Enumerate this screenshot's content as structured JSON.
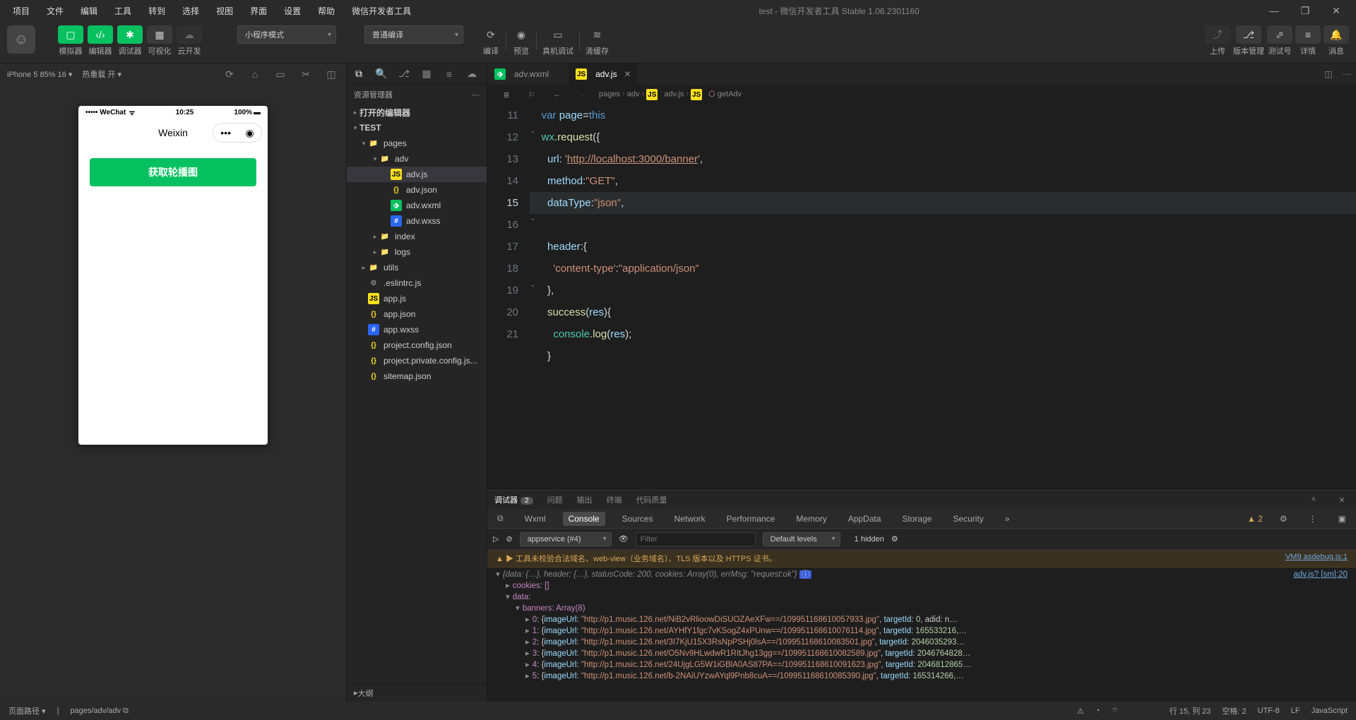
{
  "menu": [
    "项目",
    "文件",
    "编辑",
    "工具",
    "转到",
    "选择",
    "视图",
    "界面",
    "设置",
    "帮助",
    "微信开发者工具"
  ],
  "windowTitle": "test - 微信开发者工具 Stable 1.06.2301160",
  "toolbar": {
    "modes": [
      {
        "label": "模拟器"
      },
      {
        "label": "编辑器"
      },
      {
        "label": "调试器"
      },
      {
        "label": "可视化"
      },
      {
        "label": "云开发"
      }
    ],
    "modeDropdown": "小程序模式",
    "compileDropdown": "普通编译",
    "actions": [
      {
        "label": "编译"
      },
      {
        "label": "预览"
      },
      {
        "label": "真机调试"
      },
      {
        "label": "清缓存"
      }
    ],
    "right": [
      {
        "label": "上传"
      },
      {
        "label": "版本管理"
      },
      {
        "label": "测试号"
      },
      {
        "label": "详情"
      },
      {
        "label": "消息"
      }
    ]
  },
  "sim": {
    "device": "iPhone 5 85% 16",
    "reload": "热重载 开",
    "statusLeft": "••••• WeChat",
    "statusWifi": "ᯤ",
    "statusTime": "10:25",
    "statusBatt": "100%",
    "navTitle": "Weixin",
    "btn": "获取轮播图"
  },
  "explorer": {
    "title": "资源管理器",
    "sections": [
      "打开的编辑器",
      "TEST"
    ],
    "tree": [
      {
        "d": 0,
        "t": "pages",
        "k": "folder",
        "open": true
      },
      {
        "d": 1,
        "t": "adv",
        "k": "folder",
        "open": true
      },
      {
        "d": 2,
        "t": "adv.js",
        "k": "js",
        "sel": true
      },
      {
        "d": 2,
        "t": "adv.json",
        "k": "json"
      },
      {
        "d": 2,
        "t": "adv.wxml",
        "k": "wxml"
      },
      {
        "d": 2,
        "t": "adv.wxss",
        "k": "wxss"
      },
      {
        "d": 1,
        "t": "index",
        "k": "folder",
        "open": false
      },
      {
        "d": 1,
        "t": "logs",
        "k": "folder",
        "open": false
      },
      {
        "d": 0,
        "t": "utils",
        "k": "folder",
        "open": false
      },
      {
        "d": 0,
        "t": ".eslintrc.js",
        "k": "cfg"
      },
      {
        "d": 0,
        "t": "app.js",
        "k": "js"
      },
      {
        "d": 0,
        "t": "app.json",
        "k": "json"
      },
      {
        "d": 0,
        "t": "app.wxss",
        "k": "wxss"
      },
      {
        "d": 0,
        "t": "project.config.json",
        "k": "json"
      },
      {
        "d": 0,
        "t": "project.private.config.js...",
        "k": "json"
      },
      {
        "d": 0,
        "t": "sitemap.json",
        "k": "json"
      }
    ],
    "outline": "大纲"
  },
  "editor": {
    "tabs": [
      {
        "name": "adv.wxml",
        "icon": "wxml"
      },
      {
        "name": "adv.js",
        "icon": "js",
        "active": true,
        "close": true
      }
    ],
    "crumb": [
      "pages",
      "adv",
      "adv.js",
      "getAdv"
    ],
    "startLine": 11,
    "code": [
      {
        "n": 11,
        "html": "    <span class='kw'>var</span> <span class='prop'>page</span><span class='pun'>=</span><span class='kw'>this</span>"
      },
      {
        "n": 12,
        "html": "    <span class='obj'>wx</span><span class='pun'>.</span><span class='mth'>request</span><span class='pun'>({</span>"
      },
      {
        "n": 13,
        "html": "      <span class='prop'>url</span><span class='pun'>:</span> <span class='str'>'</span><span class='url'>http://localhost:3000/banner</span><span class='str'>'</span><span class='pun'>,</span>"
      },
      {
        "n": 14,
        "html": "      <span class='prop'>method</span><span class='pun'>:</span><span class='str'>\"GET\"</span><span class='pun'>,</span>"
      },
      {
        "n": 15,
        "html": "      <span class='prop'>dataType</span><span class='pun'>:</span><span class='str'>\"json\"</span><span class='pun'>,</span>",
        "cur": true
      },
      {
        "n": 16,
        "html": "      <span class='prop'>header</span><span class='pun'>:{</span>"
      },
      {
        "n": 17,
        "html": "        <span class='str'>'content-type'</span><span class='pun'>:</span><span class='str'>\"application/json\"</span>"
      },
      {
        "n": 18,
        "html": "      <span class='pun'>},</span>"
      },
      {
        "n": 19,
        "html": "      <span class='mth'>success</span><span class='pun'>(</span><span class='prop'>res</span><span class='pun'>){</span>"
      },
      {
        "n": 20,
        "html": "        <span class='obj'>console</span><span class='pun'>.</span><span class='mth'>log</span><span class='pun'>(</span><span class='prop'>res</span><span class='pun'>);</span>"
      },
      {
        "n": 21,
        "html": "      <span class='pun'>}</span>"
      }
    ]
  },
  "debug": {
    "tabs1": [
      {
        "t": "调试器",
        "badge": "2",
        "act": true
      },
      {
        "t": "问题"
      },
      {
        "t": "输出"
      },
      {
        "t": "终端"
      },
      {
        "t": "代码质量"
      }
    ],
    "tabs2": [
      "Wxml",
      "Console",
      "Sources",
      "Network",
      "Performance",
      "Memory",
      "AppData",
      "Storage",
      "Security"
    ],
    "tabs2active": "Console",
    "more": "»",
    "warnCount": "2",
    "context": "appservice (#4)",
    "filterPlaceholder": "Filter",
    "levels": "Default levels",
    "hidden": "1 hidden",
    "warnRow": "▲ ▶ 工具未校验合法域名、web-view（业务域名）、TLS 版本以及 HTTPS 证书。",
    "warnLink": "VM9 asdebug.js:1",
    "srcLink": "adv.js? [sm]:20",
    "objSummary": "{data: {…}, header: {…}, statusCode: 200, cookies: Array(0), errMsg: \"request:ok\"}",
    "cookies": "cookies: []",
    "dataLabel": "data:",
    "bannersLabel": "banners: Array(8)",
    "banners": [
      {
        "i": 0,
        "url": "http://p1.music.126.net/NiB2vRlioowDiSUOZAeXFw==/109951168610057933.jpg",
        "tid": "0",
        "extra": ", adid: n…"
      },
      {
        "i": 1,
        "url": "http://p1.music.126.net/AYHfY1fgc7vKSogZ4xPUnw==/109951168610076114.jpg",
        "tid": "165533216,…"
      },
      {
        "i": 2,
        "url": "http://p1.music.126.net/3I7KjU15X3RsNpPSHj0lsA==/109951168610083501.jpg",
        "tid": "2046035293…"
      },
      {
        "i": 3,
        "url": "http://p1.music.126.net/O5Nv9HLwdwR1RItJhg13gg==/109951168610082589.jpg",
        "tid": "2046764828…"
      },
      {
        "i": 4,
        "url": "http://p1.music.126.net/24UjgLG5W1iGBlA0AS87PA==/109951168610091623.jpg",
        "tid": "2046812865…"
      },
      {
        "i": 5,
        "url": "http://p1.music.126.net/b-2NAiUYzwAYql9Pnb8cuA==/109951168610085390.jpg",
        "tid": "165314266,…"
      }
    ]
  },
  "status": {
    "pathLabel": "页面路径",
    "path": "pages/adv/adv",
    "pos": "行 15, 列 23",
    "spaces": "空格: 2",
    "enc": "UTF-8",
    "eol": "LF",
    "lang": "JavaScript"
  }
}
